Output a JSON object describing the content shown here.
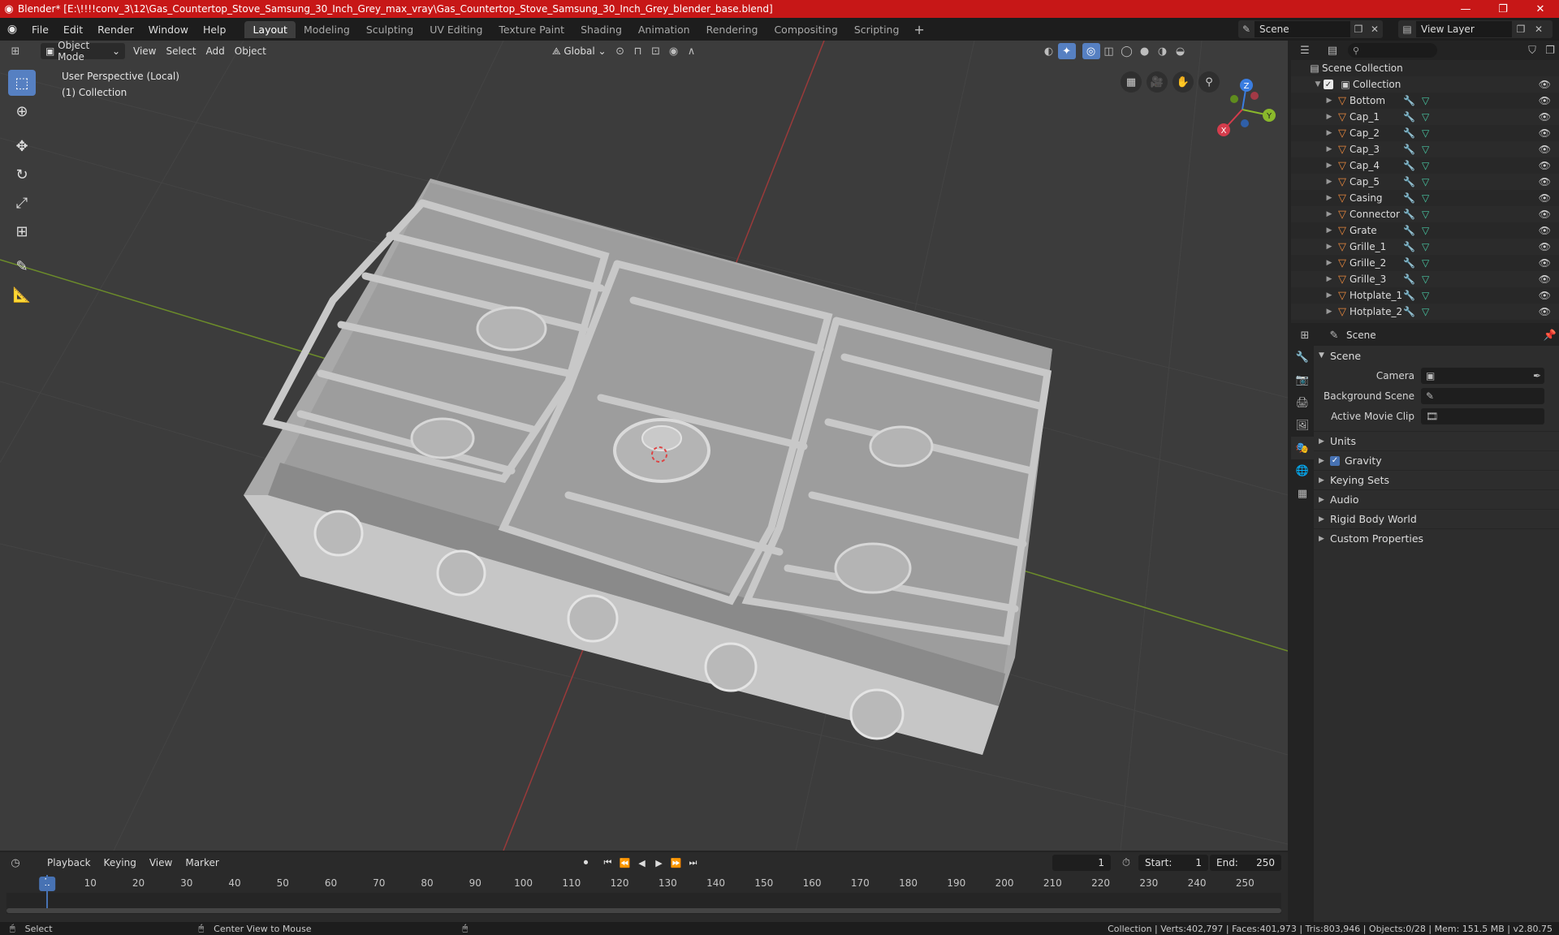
{
  "titlebar": {
    "title": "Blender* [E:\\!!!!conv_3\\12\\Gas_Countertop_Stove_Samsung_30_Inch_Grey_max_vray\\Gas_Countertop_Stove_Samsung_30_Inch_Grey_blender_base.blend]",
    "minimize": "—",
    "maximize": "❐",
    "close": "✕"
  },
  "menu": {
    "items": [
      "File",
      "Edit",
      "Render",
      "Window",
      "Help"
    ],
    "workspaces": [
      "Layout",
      "Modeling",
      "Sculpting",
      "UV Editing",
      "Texture Paint",
      "Shading",
      "Animation",
      "Rendering",
      "Compositing",
      "Scripting"
    ],
    "active_workspace": "Layout",
    "scene": "Scene",
    "view_layer": "View Layer"
  },
  "viewport": {
    "mode": "Object Mode",
    "menus": [
      "View",
      "Select",
      "Add",
      "Object"
    ],
    "orientation": "Global",
    "info_line1": "User Perspective (Local)",
    "info_line2": "(1) Collection",
    "gizmo": {
      "x": "X",
      "y": "Y",
      "z": "Z"
    }
  },
  "outliner": {
    "root": "Scene Collection",
    "collection": "Collection",
    "items": [
      "Bottom",
      "Cap_1",
      "Cap_2",
      "Cap_3",
      "Cap_4",
      "Cap_5",
      "Casing",
      "Connector",
      "Grate",
      "Grille_1",
      "Grille_2",
      "Grille_3",
      "Hotplate_1",
      "Hotplate_2"
    ]
  },
  "properties": {
    "context": "Scene",
    "panel": "Scene",
    "camera_label": "Camera",
    "background_scene_label": "Background Scene",
    "active_movie_clip_label": "Active Movie Clip",
    "subpanels": [
      "Units",
      "Gravity",
      "Keying Sets",
      "Audio",
      "Rigid Body World",
      "Custom Properties"
    ]
  },
  "timeline": {
    "menus": [
      "Playback",
      "Keying",
      "View",
      "Marker"
    ],
    "current_frame": "1",
    "start_label": "Start:",
    "start": "1",
    "end_label": "End:",
    "end": "250",
    "ticks": [
      "10",
      "20",
      "30",
      "40",
      "50",
      "60",
      "70",
      "80",
      "90",
      "100",
      "110",
      "120",
      "130",
      "140",
      "150",
      "160",
      "170",
      "180",
      "190",
      "200",
      "210",
      "220",
      "230",
      "240",
      "250"
    ]
  },
  "status": {
    "select": "Select",
    "center_view": "Center View to Mouse",
    "stats": "Collection | Verts:402,797 | Faces:401,973 | Tris:803,946 | Objects:0/28 | Mem: 151.5 MB | v2.80.75"
  },
  "colors": {
    "title_red": "#c71717",
    "accent_blue": "#5680c2",
    "object_orange": "#e9883d",
    "mesh_teal": "#48c7a2"
  }
}
